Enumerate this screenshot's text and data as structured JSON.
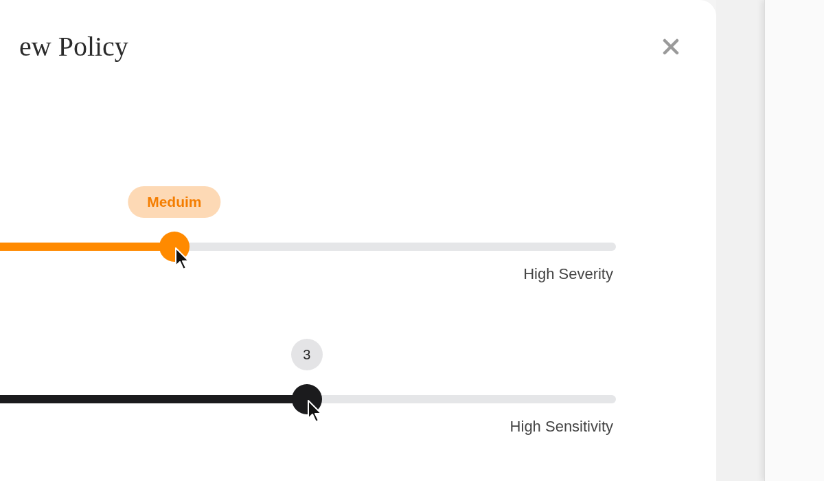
{
  "dialog": {
    "title": "ew Policy"
  },
  "sliders": [
    {
      "kind": "severity",
      "badge": "Meduim",
      "level": 0.283,
      "label": "High Severity"
    },
    {
      "kind": "sensitivity",
      "badge": "3",
      "level": 0.498,
      "label": "High Sensitivity"
    }
  ]
}
